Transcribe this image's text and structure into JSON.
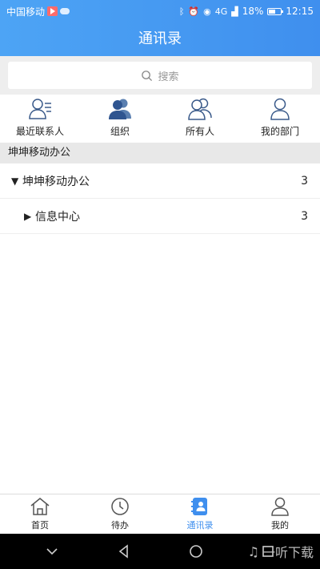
{
  "status_bar": {
    "carrier": "中国移动",
    "battery": "18%",
    "time": "12:15",
    "signal_label": "4G"
  },
  "header": {
    "title": "通讯录"
  },
  "search": {
    "placeholder": "搜索"
  },
  "quick_actions": [
    {
      "label": "最近联系人",
      "icon": "recent-contacts-icon"
    },
    {
      "label": "组织",
      "icon": "organization-icon"
    },
    {
      "label": "所有人",
      "icon": "all-people-icon"
    },
    {
      "label": "我的部门",
      "icon": "my-department-icon"
    }
  ],
  "section": {
    "title": "坤坤移动办公"
  },
  "tree": [
    {
      "caret": "▼",
      "label": "坤坤移动办公",
      "count": "3",
      "level": 0
    },
    {
      "caret": "▶",
      "label": "信息中心",
      "count": "3",
      "level": 1
    }
  ],
  "tabs": [
    {
      "label": "首页",
      "icon": "home-icon",
      "active": false
    },
    {
      "label": "待办",
      "icon": "clock-icon",
      "active": false
    },
    {
      "label": "通讯录",
      "icon": "contacts-book-icon",
      "active": true
    },
    {
      "label": "我的",
      "icon": "profile-icon",
      "active": false
    }
  ],
  "watermark": {
    "text": "一听下载"
  },
  "colors": {
    "primary": "#3f8fee",
    "header_gradient_start": "#4da4f5"
  }
}
